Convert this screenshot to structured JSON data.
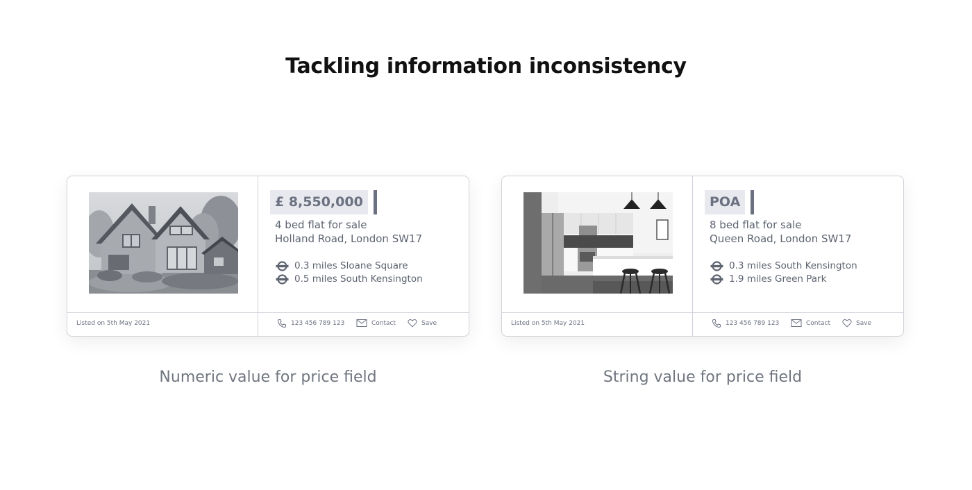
{
  "page": {
    "title": "Tackling information inconsistency"
  },
  "colors": {
    "chip_background": "#e7e9ee",
    "chip_text": "#6b7180",
    "body_text": "#5e6470",
    "border": "#cfd2d8"
  },
  "cards": [
    {
      "image": "house-photo",
      "price": "£ 8,550,000",
      "type": "4 bed flat for sale",
      "address": "Holland Road, London SW17",
      "stations": [
        "0.3 miles Sloane Square",
        "0.5 miles South Kensington"
      ],
      "station_icon": "underground-roundel-icon",
      "listed": "Listed on 5th May 2021",
      "actions": {
        "phone": "123 456 789 123",
        "contact": "Contact",
        "save": "Save"
      },
      "caption": "Numeric value for price field"
    },
    {
      "image": "kitchen-photo",
      "price": "POA",
      "type": "8 bed flat for sale",
      "address": "Queen Road, London SW17",
      "stations": [
        "0.3 miles South Kensington",
        "1.9 miles Green Park"
      ],
      "station_icon": "underground-roundel-icon",
      "listed": "Listed on 5th May 2021",
      "actions": {
        "phone": "123 456 789 123",
        "contact": "Contact",
        "save": "Save"
      },
      "caption": "String value for price field"
    }
  ]
}
